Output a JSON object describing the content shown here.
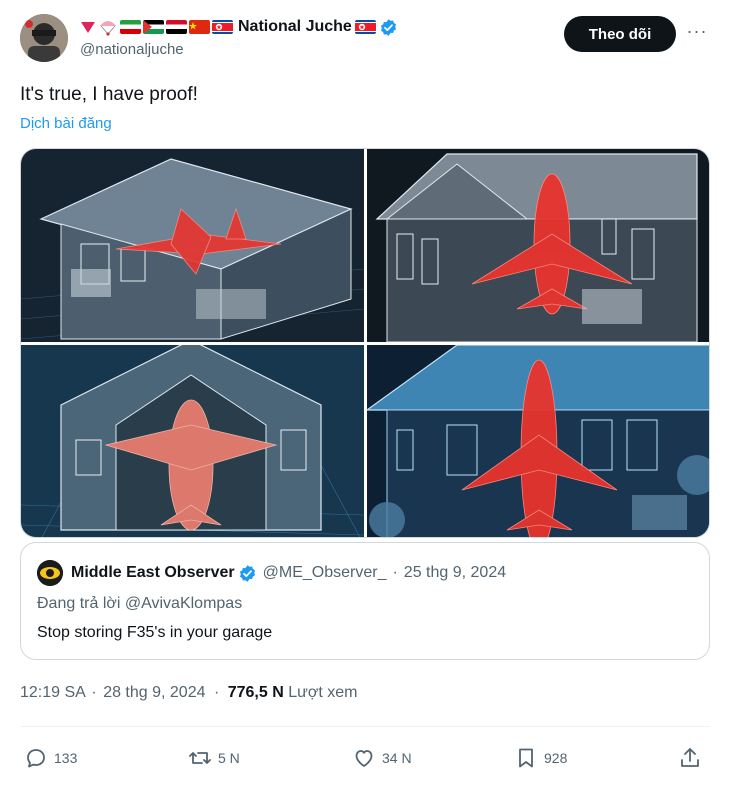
{
  "tweet": {
    "author": {
      "display_name": "National Juche",
      "handle": "@nationaljuche",
      "verified": true,
      "name_emojis": [
        "red-triangle",
        "parachute",
        "iran-flag",
        "palestine-flag",
        "yemen-flag",
        "china-flag",
        "north-korea-flag"
      ],
      "trailing_emoji": "north-korea-flag"
    },
    "follow_label": "Theo dõi",
    "more_label": "···",
    "text": "It's true, I have proof!",
    "translate_label": "Dịch bài đăng",
    "media_count": 4,
    "quote": {
      "display_name": "Middle East Observer",
      "handle": "@ME_Observer_",
      "separator": "·",
      "date": "25 thg 9, 2024",
      "reply_to": "Đang trả lời @AvivaKlompas",
      "text": "Stop storing F35's in your garage"
    },
    "meta": {
      "time": "12:19 SA",
      "date": "28 thg 9, 2024",
      "dot": "·",
      "views": "776,5 N",
      "views_label": "Lượt xem"
    },
    "actions": {
      "replies": "133",
      "reposts": "5 N",
      "likes": "34 N",
      "bookmarks": "928"
    }
  },
  "colors": {
    "accent": "#1d9bf0",
    "text": "#0f1419",
    "secondary": "#536471",
    "border": "#cfd9de"
  }
}
